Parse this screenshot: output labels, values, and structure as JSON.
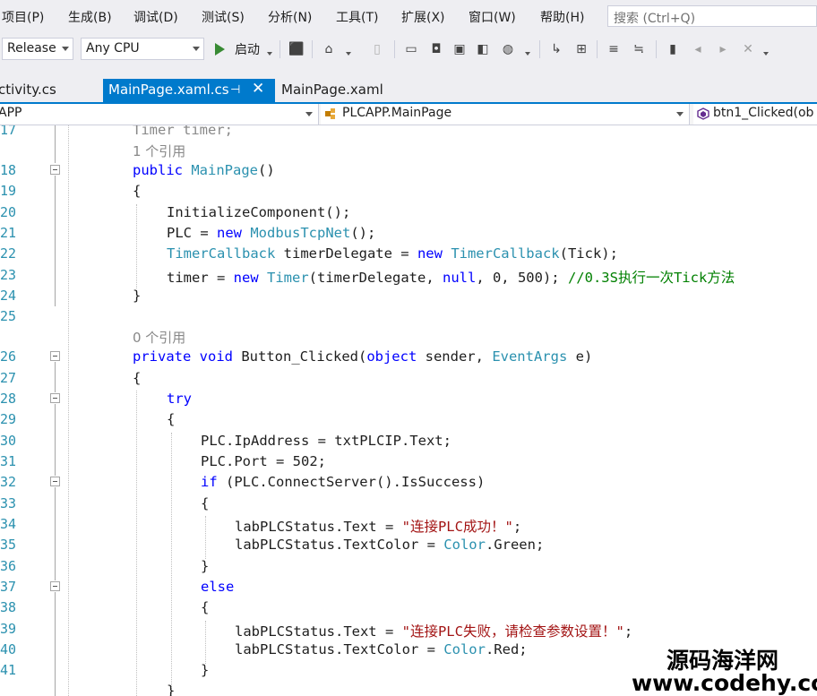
{
  "menu": {
    "items": [
      "项目(P)",
      "生成(B)",
      "调试(D)",
      "测试(S)",
      "分析(N)",
      "工具(T)",
      "扩展(X)",
      "窗口(W)",
      "帮助(H)"
    ],
    "search_placeholder": "搜索 (Ctrl+Q)"
  },
  "toolbar": {
    "configuration": "Release",
    "platform": "Any CPU",
    "start_label": "启动"
  },
  "tabs": [
    {
      "label": "ctivity.cs",
      "active": false
    },
    {
      "label": "MainPage.xaml.cs",
      "active": true
    },
    {
      "label": "MainPage.xaml",
      "active": false
    }
  ],
  "nav": {
    "project": "APP",
    "class": "PLCAPP.MainPage",
    "member": "btn1_Clicked(ob"
  },
  "code": {
    "line_numbers": [
      "17",
      "18",
      "19",
      "20",
      "21",
      "22",
      "23",
      "24",
      "25",
      "26",
      "27",
      "28",
      "29",
      "30",
      "31",
      "32",
      "33",
      "34",
      "35",
      "36",
      "37",
      "38",
      "39",
      "40",
      "41"
    ],
    "codelens": [
      "1 个引用",
      "0 个引用"
    ],
    "lines": {
      "l17": "Timer timer;",
      "l18_kw": "public",
      "l18_ty": "MainPage",
      "l18_rest": "()",
      "l19": "{",
      "l20": "InitializeComponent();",
      "l21_a": "PLC = ",
      "l21_kw": "new",
      "l21_ty": "ModbusTcpNet",
      "l21_b": "();",
      "l22_ty": "TimerCallback",
      "l22_a": " timerDelegate = ",
      "l22_kw": "new",
      "l22_ty2": "TimerCallback",
      "l22_b": "(Tick);",
      "l23_a": "timer = ",
      "l23_kw": "new",
      "l23_ty": "Timer",
      "l23_b": "(timerDelegate, ",
      "l23_null": "null",
      "l23_c": ", 0, 500); ",
      "l23_cm": "//0.3S执行一次Tick方法",
      "l24": "}",
      "l26_kw1": "private",
      "l26_kw2": "void",
      "l26_a": " Button_Clicked(",
      "l26_kw3": "object",
      "l26_b": " sender, ",
      "l26_ty": "EventArgs",
      "l26_c": " e)",
      "l27": "{",
      "l28_kw": "try",
      "l29": "{",
      "l30": "PLC.IpAddress = txtPLCIP.Text;",
      "l31": "PLC.Port = 502;",
      "l32_kw": "if",
      "l32_a": " (PLC.ConnectServer().IsSuccess)",
      "l33": "{",
      "l34_a": "labPLCStatus.Text = ",
      "l34_str": "\"连接PLC成功！\"",
      "l34_b": ";",
      "l35_a": "labPLCStatus.TextColor = ",
      "l35_ty": "Color",
      "l35_b": ".Green;",
      "l36": "}",
      "l37_kw": "else",
      "l38": "{",
      "l39_a": "labPLCStatus.Text = ",
      "l39_str": "\"连接PLC失败，请检查参数设置！\"",
      "l39_b": ";",
      "l40_a": "labPLCStatus.TextColor = ",
      "l40_ty": "Color",
      "l40_b": ".Red;",
      "l41": "}",
      "l42": "}"
    }
  },
  "watermark": {
    "line1": "源码海洋网",
    "line2": "www.codehy.com"
  },
  "colors": {
    "accent": "#007acc",
    "keyword": "#0000ff",
    "type": "#2b91af",
    "string": "#a31515",
    "comment": "#008000"
  }
}
